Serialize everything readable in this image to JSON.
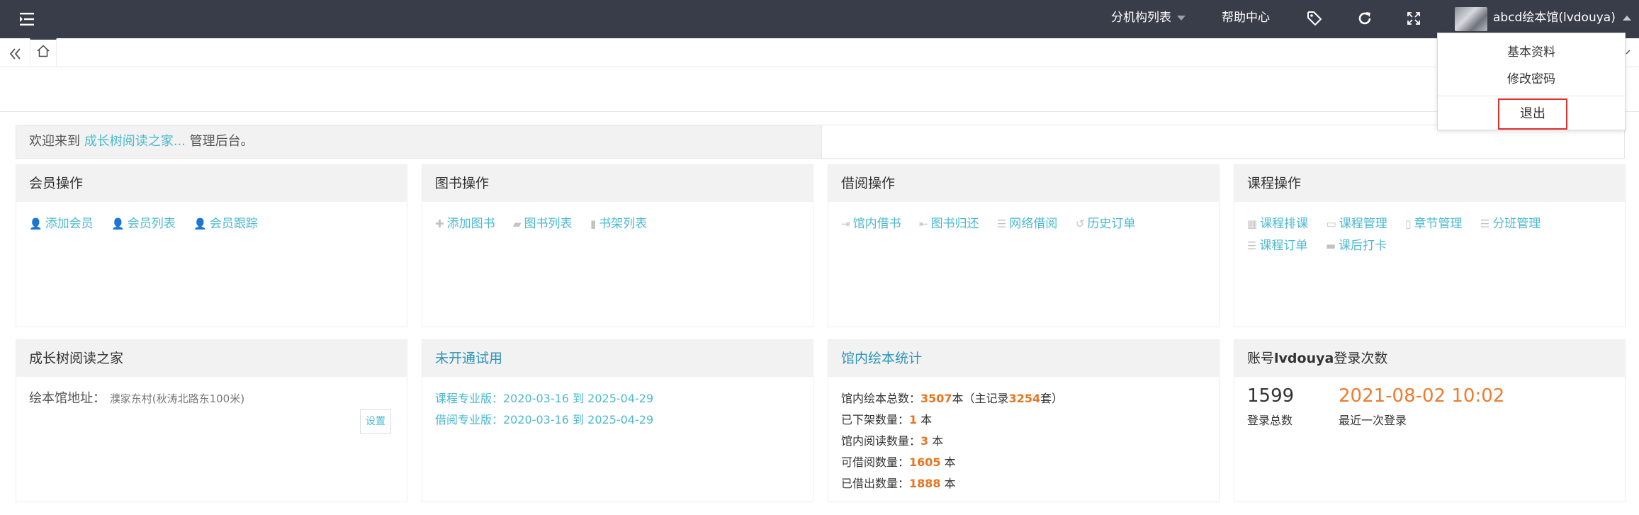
{
  "topbar": {
    "branch_list": "分机构列表",
    "help_center": "帮助中心",
    "user_name": "abcd绘本馆(lvdouya)"
  },
  "dropdown": {
    "profile": "基本资料",
    "change_password": "修改密码",
    "logout": "退出"
  },
  "welcome": {
    "prefix": "欢迎来到",
    "org_name": "成长树阅读之家...",
    "suffix": "管理后台。"
  },
  "cards": {
    "member": {
      "title": "会员操作",
      "ops": [
        "添加会员",
        "会员列表",
        "会员跟踪"
      ]
    },
    "book": {
      "title": "图书操作",
      "ops": [
        "添加图书",
        "图书列表",
        "书架列表"
      ]
    },
    "borrow": {
      "title": "借阅操作",
      "ops": [
        "馆内借书",
        "图书归还",
        "网络借阅",
        "历史订单"
      ]
    },
    "course": {
      "title": "课程操作",
      "ops": [
        "课程排课",
        "课程管理",
        "章节管理",
        "分班管理",
        "课程订单",
        "课后打卡"
      ]
    },
    "library": {
      "title": "成长树阅读之家",
      "address_label": "绘本馆地址：",
      "address_value": "濮家东村(秋涛北路东100米)",
      "set_button": "设置"
    },
    "trial": {
      "title": "未开通试用",
      "course_line": "课程专业版：2020-03-16 到 2025-04-29",
      "borrow_line": "借阅专业版：2020-03-16 到 2025-04-29"
    },
    "stats": {
      "title": "馆内绘本统计",
      "total_label": "馆内绘本总数：",
      "total_value": "3507",
      "total_unit": "本（主记录",
      "master_value": "3254",
      "master_unit": "套）",
      "off_label": "已下架数量：",
      "off_value": "1",
      "reading_label": "馆内阅读数量：",
      "reading_value": "3",
      "available_label": "可借阅数量：",
      "available_value": "1605",
      "lent_label": "已借出数量：",
      "lent_value": "1888",
      "unit": "本"
    },
    "login": {
      "title_prefix": "账号",
      "title_account": "lvdouya",
      "title_suffix": "登录次数",
      "count": "1599",
      "count_label": "登录总数",
      "last_time": "2021-08-02 10:02",
      "last_label": "最近一次登录"
    }
  }
}
